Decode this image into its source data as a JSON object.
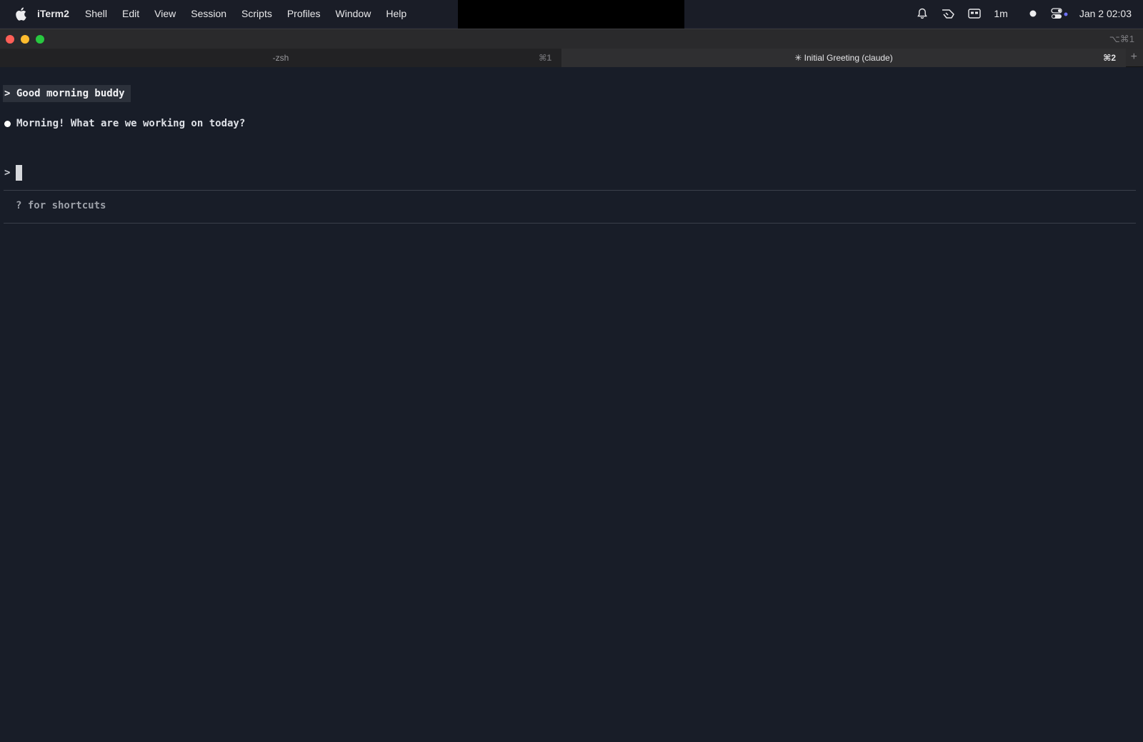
{
  "menubar": {
    "app_name": "iTerm2",
    "items": [
      "Shell",
      "Edit",
      "View",
      "Session",
      "Scripts",
      "Profiles",
      "Window",
      "Help"
    ],
    "status": {
      "timer": "1m",
      "datetime": "Jan 2  02:03"
    }
  },
  "notch": {
    "progress": 1.0,
    "accent": "#e0775e"
  },
  "window": {
    "title_shortcut": "⌥⌘1",
    "tabs": [
      {
        "label": "-zsh",
        "key": "⌘1"
      },
      {
        "label": "✳ Initial Greeting (claude)",
        "key": "⌘2"
      }
    ],
    "new_tab": "+"
  },
  "terminal": {
    "user_message": "> Good morning buddy",
    "assistant_reply": "Morning! What are we working on today?",
    "prompt_symbol": ">",
    "hint": "? for shortcuts"
  }
}
